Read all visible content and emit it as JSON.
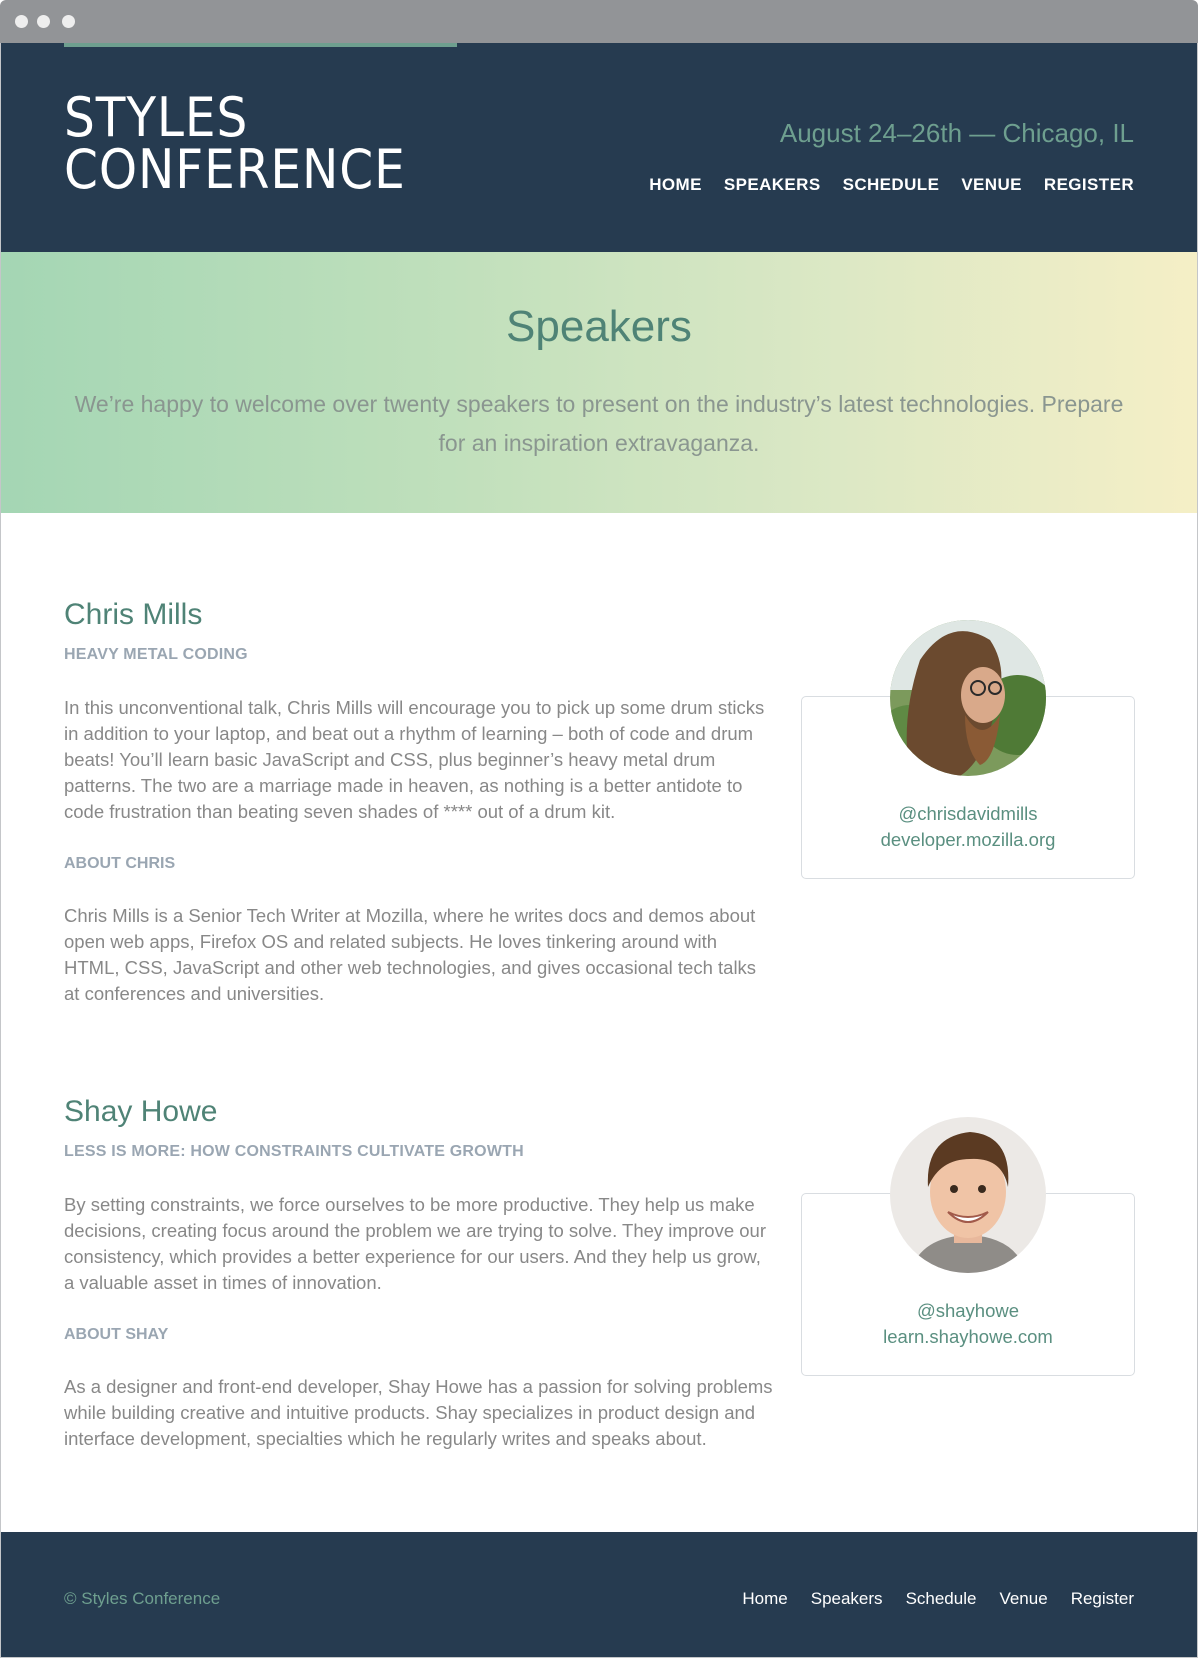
{
  "site": {
    "logo_line1": "STYLES",
    "logo_line2": "CONFERENCE",
    "dates": "August 24–26th — Chicago, IL",
    "nav": [
      "HOME",
      "SPEAKERS",
      "SCHEDULE",
      "VENUE",
      "REGISTER"
    ]
  },
  "hero": {
    "title": "Speakers",
    "subtitle": "We’re happy to welcome over twenty speakers to present on the industry’s latest technologies. Prepare for an inspiration extravaganza."
  },
  "speakers": [
    {
      "name": "Chris Mills",
      "talk_title": "HEAVY METAL CODING",
      "talk_description": "In this unconventional talk, Chris Mills will encourage you to pick up some drum sticks in addition to your laptop, and beat out a rhythm of learning – both of code and drum beats! You’ll learn basic JavaScript and CSS, plus beginner’s heavy metal drum patterns. The two are a marriage made in heaven, as nothing is a better antidote to code frustration than beating seven shades of **** out of a drum kit.",
      "about_heading": "ABOUT CHRIS",
      "about": "Chris Mills is a Senior Tech Writer at Mozilla, where he writes docs and demos about open web apps, Firefox OS and related subjects. He loves tinkering around with HTML, CSS, JavaScript and other web technologies, and gives occasional tech talks at conferences and universities.",
      "handle": "@chrisdavidmills",
      "website": "developer.mozilla.org"
    },
    {
      "name": "Shay Howe",
      "talk_title": "LESS IS MORE: HOW CONSTRAINTS CULTIVATE GROWTH",
      "talk_description": "By setting constraints, we force ourselves to be more productive. They help us make decisions, creating focus around the problem we are trying to solve. They improve our consistency, which provides a better experience for our users. And they help us grow, a valuable asset in times of innovation.",
      "about_heading": "ABOUT SHAY",
      "about": "As a designer and front-end developer, Shay Howe has a passion for solving problems while building creative and intuitive products. Shay specializes in product design and interface development, specialties which he regularly writes and speaks about.",
      "handle": "@shayhowe",
      "website": "learn.shayhowe.com"
    }
  ],
  "footer": {
    "copyright": "© Styles Conference",
    "nav": [
      "Home",
      "Speakers",
      "Schedule",
      "Venue",
      "Register"
    ]
  },
  "colors": {
    "header_bg": "#263b50",
    "accent": "#6e9f8f",
    "hero_gradient_start": "#a4d6b4",
    "hero_gradient_end": "#f5efc6"
  }
}
